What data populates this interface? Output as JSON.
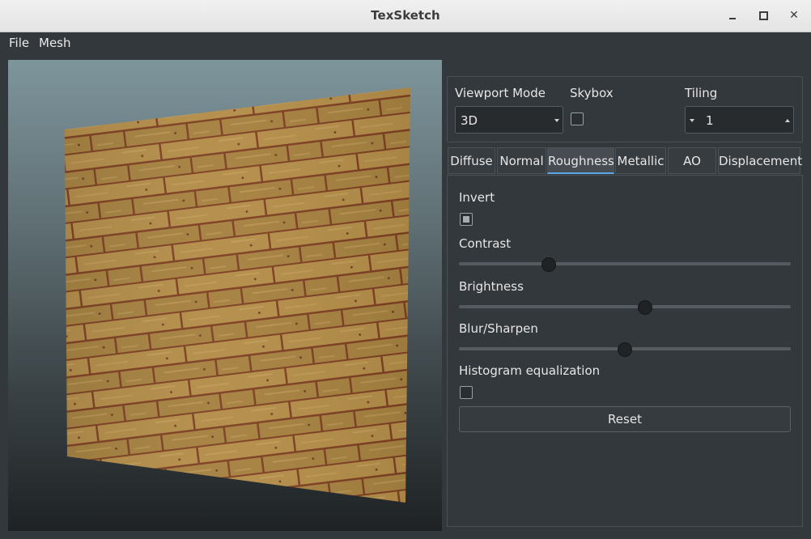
{
  "window": {
    "title": "TexSketch"
  },
  "menubar": {
    "items": [
      "File",
      "Mesh"
    ]
  },
  "viewport_settings": {
    "mode_label": "Viewport Mode",
    "mode_value": "3D",
    "skybox_label": "Skybox",
    "skybox_checked": false,
    "tiling_label": "Tiling",
    "tiling_value": "1"
  },
  "tabs": [
    {
      "label": "Diffuse",
      "active": false
    },
    {
      "label": "Normal",
      "active": false
    },
    {
      "label": "Roughness",
      "active": true
    },
    {
      "label": "Metallic",
      "active": false
    },
    {
      "label": "AO",
      "active": false
    },
    {
      "label": "Displacement",
      "active": false
    }
  ],
  "roughness": {
    "invert_label": "Invert",
    "invert_checked": true,
    "contrast_label": "Contrast",
    "contrast_value": 0.27,
    "brightness_label": "Brightness",
    "brightness_value": 0.56,
    "blur_label": "Blur/Sharpen",
    "blur_value": 0.5,
    "histogram_label": "Histogram equalization",
    "histogram_checked": false,
    "reset_label": "Reset"
  },
  "colors": {
    "accent": "#5aa9e6",
    "wood": "#b08a44",
    "mortar": "#8b4a25"
  }
}
